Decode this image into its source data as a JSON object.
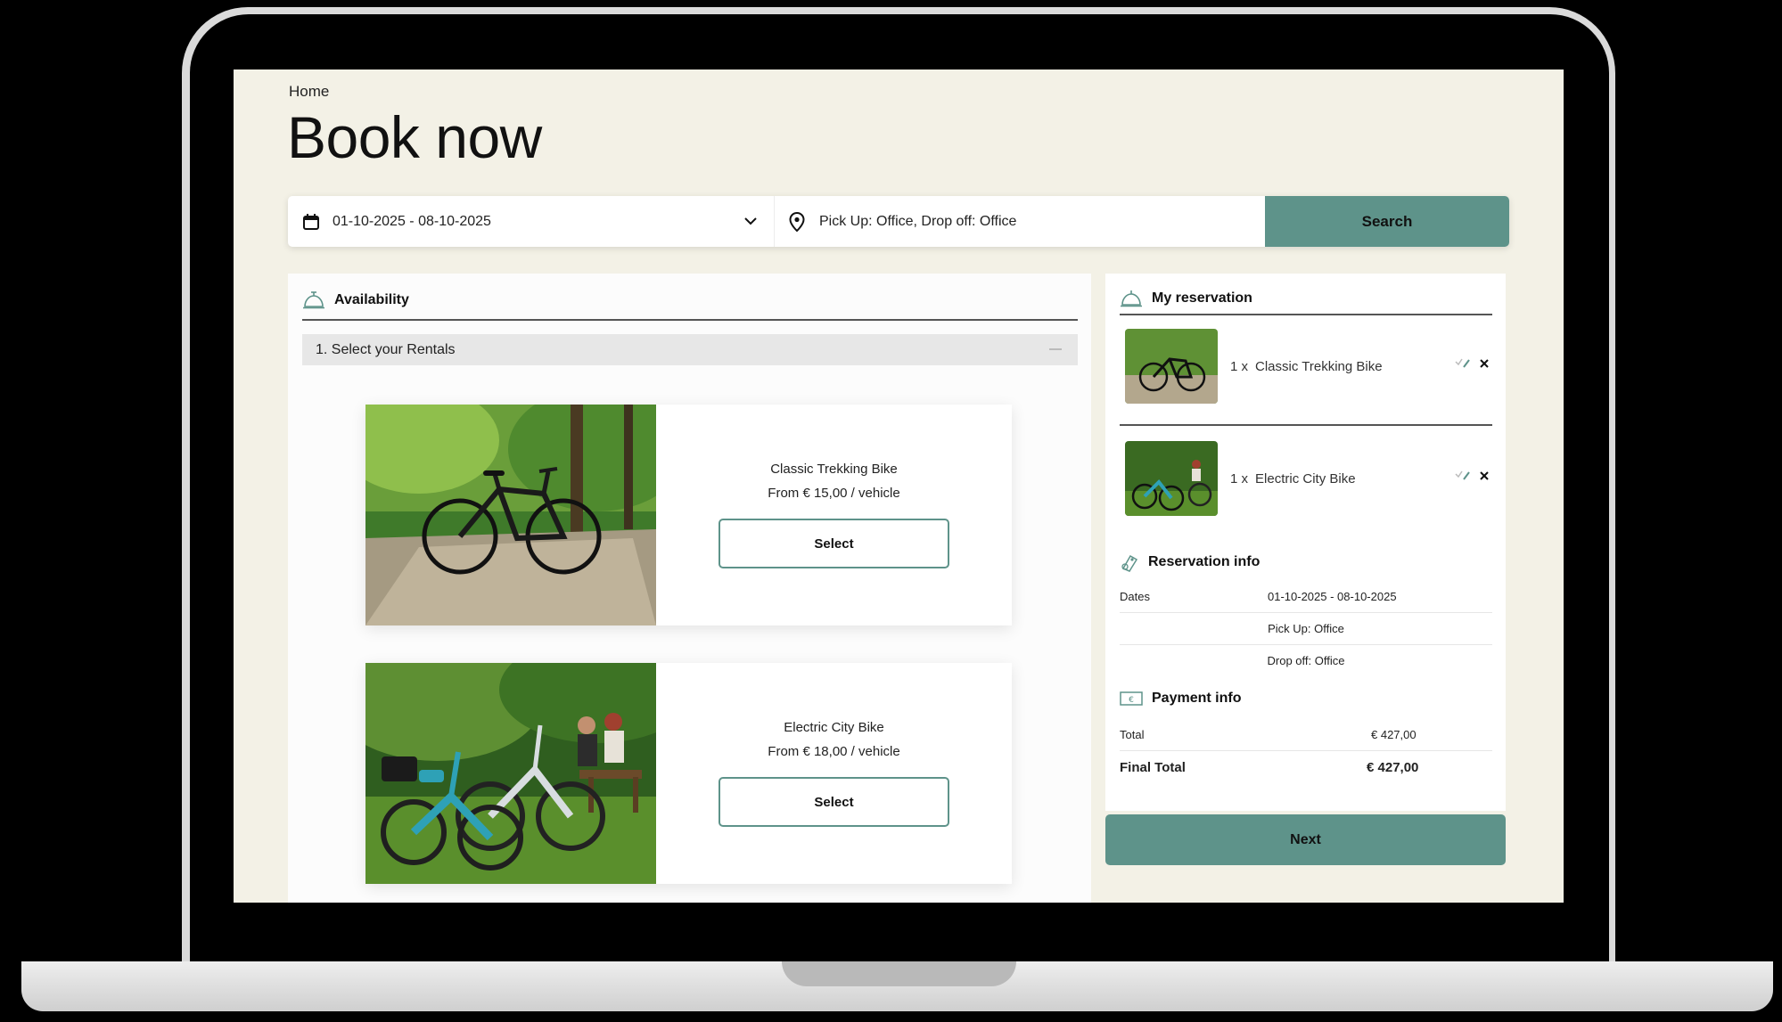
{
  "breadcrumb": "Home",
  "page_title": "Book now",
  "search": {
    "dates": "01-10-2025 - 08-10-2025",
    "location": "Pick Up: Office, Drop off: Office",
    "button": "Search"
  },
  "availability": {
    "title": "Availability",
    "step": "1.  Select your Rentals",
    "rentals": [
      {
        "name": "Classic Trekking Bike",
        "price": "From € 15,00 / vehicle",
        "button": "Select"
      },
      {
        "name": "Electric City Bike",
        "price": "From € 18,00 / vehicle",
        "button": "Select"
      }
    ]
  },
  "reservation": {
    "title": "My reservation",
    "items": [
      {
        "qty": "1 x",
        "name": "Classic Trekking Bike"
      },
      {
        "qty": "1 x",
        "name": "Electric City Bike"
      }
    ],
    "info_title": "Reservation info",
    "dates_label": "Dates",
    "dates_value": "01-10-2025 - 08-10-2025",
    "pickup": "Pick Up: Office",
    "dropoff": "Drop off: Office",
    "payment_title": "Payment info",
    "total_label": "Total",
    "total_value": "€  427,00",
    "final_label": "Final Total",
    "final_value": "€  427,00"
  },
  "next_button": "Next",
  "colors": {
    "accent": "#5e938a",
    "page_bg": "#f3f1e6"
  },
  "icons": [
    "calendar-icon",
    "chevron-down-icon",
    "location-pin-icon",
    "service-bell-icon",
    "check-icon",
    "edit-pencil-icon",
    "close-icon",
    "bike-tag-icon",
    "euro-note-icon"
  ]
}
